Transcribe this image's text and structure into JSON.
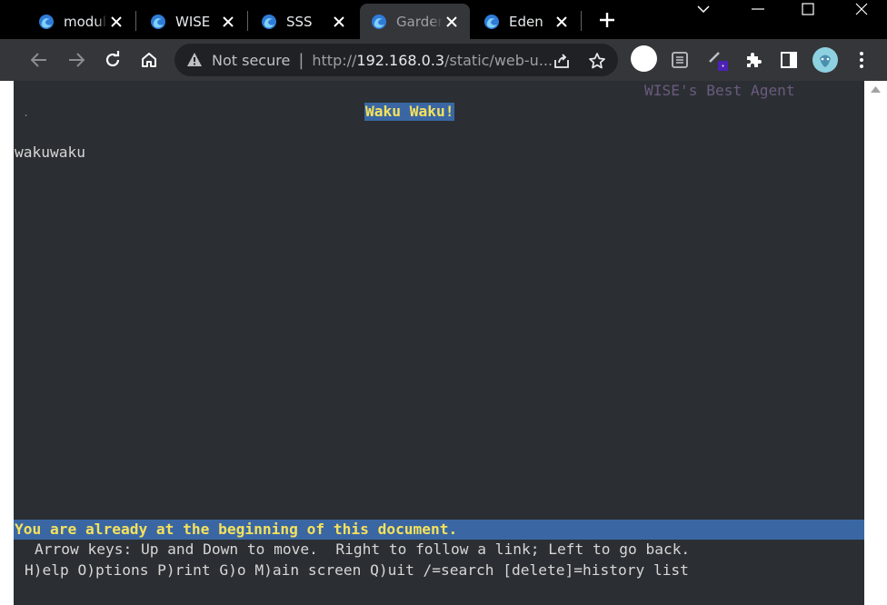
{
  "tabs": [
    {
      "label": "modul",
      "active": false
    },
    {
      "label": "WISE",
      "active": false
    },
    {
      "label": "SSS",
      "active": false
    },
    {
      "label": "Garden",
      "active": true
    },
    {
      "label": "Eden",
      "active": false
    }
  ],
  "address_bar": {
    "security_label": "Not secure",
    "url_scheme": "http://",
    "url_host": "192.168.0.3",
    "url_path": "/static/web-u..."
  },
  "page": {
    "agent_banner": "WISE's Best Agent",
    "corner_mark": ".",
    "title": "Waku Waku!",
    "body": "wakuwaku",
    "status_message": "You are already at the beginning of this document.",
    "help_line_1": "Arrow keys: Up and Down to move.  Right to follow a link; Left to go back.",
    "help_line_2": "H)elp O)ptions P)rint G)o M)ain screen Q)uit /=search [delete]=history list"
  },
  "colors": {
    "titlebar": "#000000",
    "toolbar": "#35363a",
    "terminal_bg": "#2b2f33",
    "highlight_bg": "#3a67a3",
    "highlight_fg": "#f5e15c"
  }
}
